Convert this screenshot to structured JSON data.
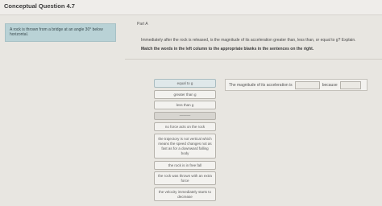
{
  "header": {
    "title": "Conceptual Question 4.7"
  },
  "problem": {
    "text": "A rock is thrown from a bridge at an angle 30° below horizontal."
  },
  "part": {
    "label": "Part A"
  },
  "question": {
    "text": "Immediately after the rock is released, is the magnitude of its acceleration greater than, less than, or equal to g? Explain.",
    "instruction": "Match the words in the left column to the appropriate blanks in the sentences on the right."
  },
  "choices": [
    "equal to g",
    "greater than g",
    "less than g",
    "———",
    "no force acts on the rock",
    "the trajectory is not vertical which means the speed changes not as fast as for a downward falling body",
    "the rock is in free fall",
    "the rock was thrown with an extra force",
    "the velocity immediately starts to decrease"
  ],
  "sentence": {
    "prefix": "The magnitude of its acceleration is",
    "middle": "because"
  }
}
